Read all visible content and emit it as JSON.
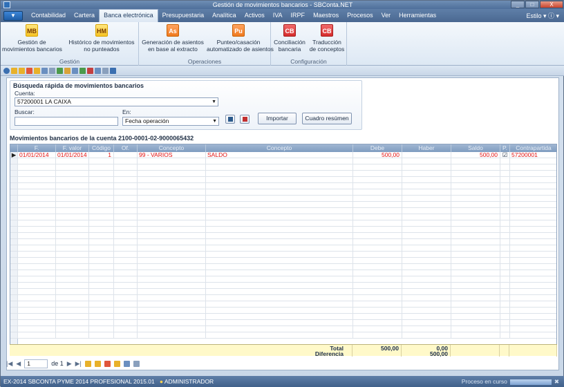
{
  "window": {
    "title": "Gestión de movimientos bancarios - SBConta.NET",
    "controls": [
      "_",
      "□",
      "X"
    ]
  },
  "menu": {
    "app_button": "",
    "items": [
      "Contabilidad",
      "Cartera",
      "Banca electrónica",
      "Presupuestaria",
      "Analítica",
      "Activos",
      "IVA",
      "IRPF",
      "Maestros",
      "Procesos",
      "Ver",
      "Herramientas"
    ],
    "active": "Banca electrónica",
    "estilo": "Estilo"
  },
  "ribbon": {
    "groups": [
      {
        "label": "Gestión",
        "buttons": [
          {
            "icon": "MB",
            "label1": "Gestión de",
            "label2": "movimientos bancarios",
            "color": "yel"
          },
          {
            "icon": "HM",
            "label1": "Histórico de movimientos",
            "label2": "no punteados",
            "color": "yel"
          }
        ]
      },
      {
        "label": "Operaciones",
        "buttons": [
          {
            "icon": "As",
            "label1": "Generación de asientos",
            "label2": "en base al extracto",
            "color": "ora"
          },
          {
            "icon": "Pu",
            "label1": "Punteo/casación",
            "label2": "automatizado de asientos",
            "color": "ora"
          }
        ]
      },
      {
        "label": "Configuración",
        "buttons": [
          {
            "icon": "CB",
            "label1": "Conciliación",
            "label2": "bancaria",
            "color": "red"
          },
          {
            "icon": "CB",
            "label1": "Traducción",
            "label2": "de conceptos",
            "color": "red"
          }
        ]
      }
    ]
  },
  "search": {
    "title": "Búsqueda rápida de movimientos bancarios",
    "cuenta_label": "Cuenta:",
    "cuenta_value": "57200001 LA CAIXA",
    "buscar_label": "Buscar:",
    "buscar_value": "",
    "en_label": "En:",
    "en_value": "Fecha operación",
    "importar": "Importar",
    "cuadro": "Cuadro resúmen"
  },
  "grid": {
    "title": "Movimientos bancarios de la cuenta 2100-0001-02-9000065432",
    "headers": [
      "F.",
      "F. valor",
      "Código",
      "Of.",
      "Concepto",
      "Concepto",
      "Debe",
      "Haber",
      "Saldo",
      "P.",
      "Contrapartida"
    ],
    "rows": [
      {
        "f": "01/01/2014",
        "fvalor": "01/01/2014",
        "codigo": "1",
        "of": "",
        "concepto1": "99 - VARIOS",
        "concepto2": "SALDO",
        "debe": "500,00",
        "haber": "",
        "saldo": "500,00",
        "p": "☑",
        "contrapartida": "57200001"
      }
    ],
    "footer": {
      "total_label": "Total",
      "diferencia_label": "Diferencia",
      "debe_total": "500,00",
      "haber_total": "0,00",
      "haber_diferencia": "500,00"
    }
  },
  "pager": {
    "page": "1",
    "of_text": "de 1"
  },
  "status": {
    "text": "EX-2014  SBCONTA PYME 2014  PROFESIONAL 2015.01",
    "user": "ADMINISTRADOR",
    "right": "Proceso en curso"
  }
}
